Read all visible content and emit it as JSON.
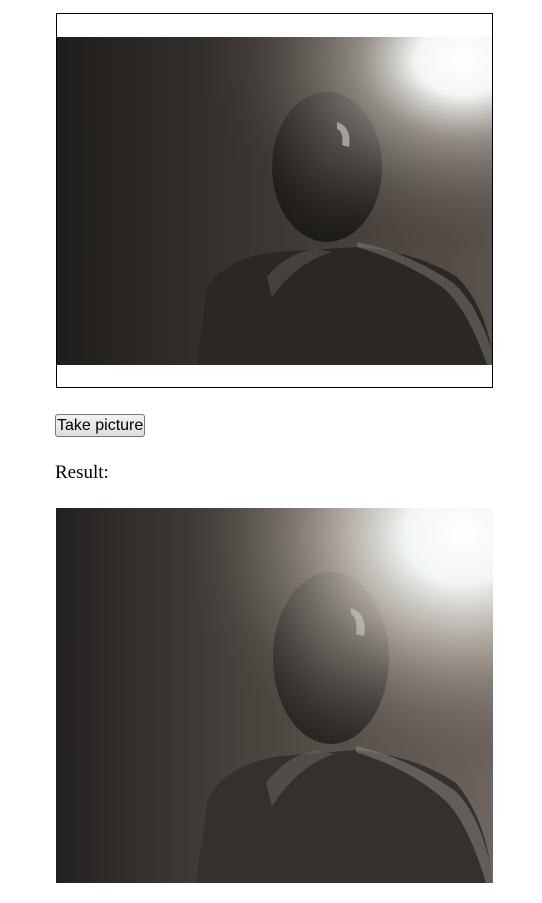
{
  "camera": {
    "feed_description_icon": "webcam-live-feed"
  },
  "controls": {
    "take_picture_label": "Take picture"
  },
  "result": {
    "label": "Result:",
    "image_icon": "captured-photo"
  }
}
